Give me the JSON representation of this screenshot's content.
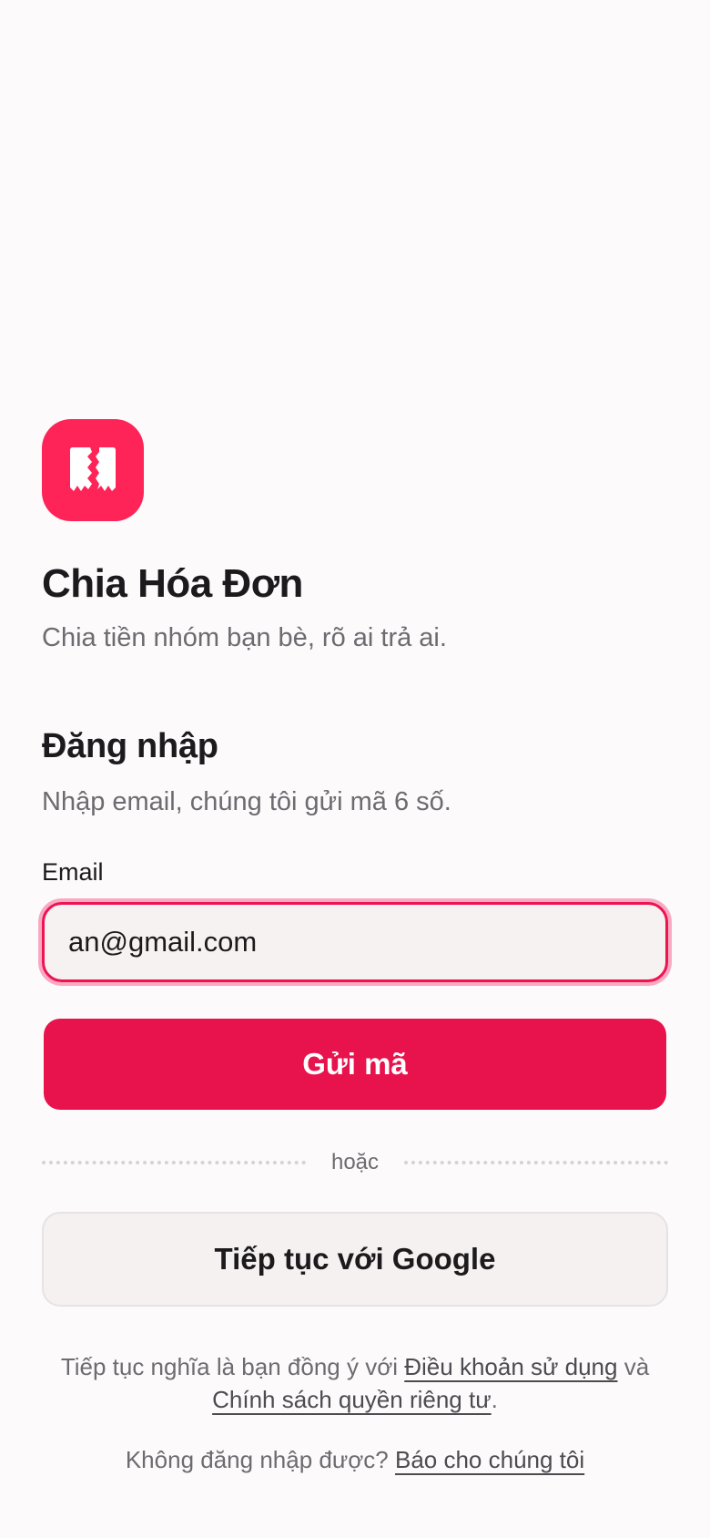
{
  "app": {
    "title": "Chia Hóa Đơn",
    "subtitle": "Chia tiền nhóm bạn bè, rõ ai trả ai.",
    "logo_icon": "receipt-split-icon",
    "accent": "#e8124c",
    "logo_color": "#ff2458"
  },
  "login": {
    "title": "Đăng nhập",
    "subtitle": "Nhập email, chúng tôi gửi mã 6 số.",
    "email_label": "Email",
    "email_value": "an@gmail.com",
    "send_code_label": "Gửi mã",
    "divider_text": "hoặc",
    "google_label": "Tiếp tục với Google"
  },
  "legal": {
    "prefix": "Tiếp tục nghĩa là bạn đồng ý với ",
    "terms_link": "Điều khoản sử dụng",
    "middle": " và ",
    "privacy_link": "Chính sách quyền riêng tư",
    "suffix": "."
  },
  "help": {
    "prefix": "Không đăng nhập được? ",
    "link": "Báo cho chúng tôi"
  }
}
